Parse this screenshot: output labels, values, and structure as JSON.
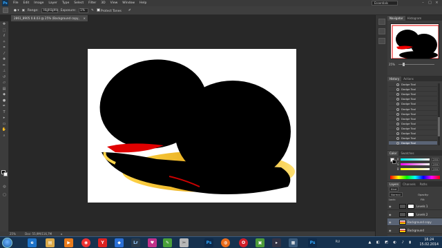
{
  "app": {
    "logo": "Ps"
  },
  "menu": [
    "File",
    "Edit",
    "Image",
    "Layer",
    "Type",
    "Select",
    "Filter",
    "3D",
    "View",
    "Window",
    "Help"
  ],
  "workspace_preset": "Essentials",
  "options": {
    "range_label": "Range:",
    "range_value": "Highlights",
    "exposure_label": "Exposure:",
    "exposure_value": "1%",
    "protect_tones": "Protect Tones"
  },
  "document": {
    "tab_title": "2861_8905 0.8.03 @ 25% (Background copy, RGB/16*) *",
    "zoom": "25%",
    "doc_info": "Doc: 55,9M/116,7M"
  },
  "navigator": {
    "tabs": [
      "Navigator",
      "Histogram"
    ],
    "zoom": "25%"
  },
  "history": {
    "tabs": [
      "History",
      "Actions"
    ],
    "items": [
      "Dodge Tool",
      "Dodge Tool",
      "Dodge Tool",
      "Dodge Tool",
      "Dodge Tool",
      "Dodge Tool",
      "Dodge Tool",
      "Dodge Tool",
      "Dodge Tool",
      "Dodge Tool",
      "Dodge Tool",
      "Dodge Tool",
      "Dodge Tool"
    ]
  },
  "color": {
    "tabs": [
      "Color",
      "Swatches"
    ],
    "channels": [
      {
        "label": "R",
        "value": "255"
      },
      {
        "label": "G",
        "value": "255"
      },
      {
        "label": "B",
        "value": "255"
      }
    ]
  },
  "layers": {
    "tabs": [
      "Layers",
      "Channels",
      "Paths"
    ],
    "kind": "Kind",
    "blend_mode": "Normal",
    "opacity_label": "Opacity:",
    "lock_label": "Lock:",
    "fill_label": "Fill:",
    "rows": [
      {
        "name": "Levels 1",
        "type": "adjustment"
      },
      {
        "name": "Levels 2",
        "type": "adjustment"
      },
      {
        "name": "Background copy",
        "type": "pixel",
        "selected": true
      },
      {
        "name": "Background",
        "type": "pixel"
      }
    ]
  },
  "taskbar": {
    "apps": [
      "ie",
      "explorer",
      "wmp",
      "chrome",
      "yandex",
      "dropbox",
      "lightroom",
      "sketch",
      "pen",
      "tools",
      "photoshop",
      "firefox",
      "opera",
      "archive",
      "terminal",
      "media",
      "photoshop2"
    ],
    "language": "RU",
    "time": "16:24",
    "date": "15.02.2014"
  },
  "colors": {
    "accent_selected": "#5a6475",
    "ps_blue": "#31a8ff",
    "taskbar": "#16314e"
  }
}
